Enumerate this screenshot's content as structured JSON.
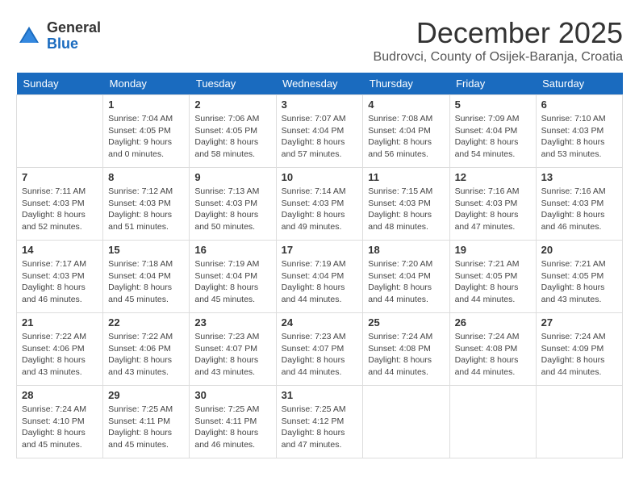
{
  "logo": {
    "general": "General",
    "blue": "Blue"
  },
  "title": {
    "month": "December 2025",
    "location": "Budrovci, County of Osijek-Baranja, Croatia"
  },
  "days_of_week": [
    "Sunday",
    "Monday",
    "Tuesday",
    "Wednesday",
    "Thursday",
    "Friday",
    "Saturday"
  ],
  "weeks": [
    [
      {
        "day": "",
        "sunrise": "",
        "sunset": "",
        "daylight": ""
      },
      {
        "day": "1",
        "sunrise": "Sunrise: 7:04 AM",
        "sunset": "Sunset: 4:05 PM",
        "daylight": "Daylight: 9 hours and 0 minutes."
      },
      {
        "day": "2",
        "sunrise": "Sunrise: 7:06 AM",
        "sunset": "Sunset: 4:05 PM",
        "daylight": "Daylight: 8 hours and 58 minutes."
      },
      {
        "day": "3",
        "sunrise": "Sunrise: 7:07 AM",
        "sunset": "Sunset: 4:04 PM",
        "daylight": "Daylight: 8 hours and 57 minutes."
      },
      {
        "day": "4",
        "sunrise": "Sunrise: 7:08 AM",
        "sunset": "Sunset: 4:04 PM",
        "daylight": "Daylight: 8 hours and 56 minutes."
      },
      {
        "day": "5",
        "sunrise": "Sunrise: 7:09 AM",
        "sunset": "Sunset: 4:04 PM",
        "daylight": "Daylight: 8 hours and 54 minutes."
      },
      {
        "day": "6",
        "sunrise": "Sunrise: 7:10 AM",
        "sunset": "Sunset: 4:03 PM",
        "daylight": "Daylight: 8 hours and 53 minutes."
      }
    ],
    [
      {
        "day": "7",
        "sunrise": "Sunrise: 7:11 AM",
        "sunset": "Sunset: 4:03 PM",
        "daylight": "Daylight: 8 hours and 52 minutes."
      },
      {
        "day": "8",
        "sunrise": "Sunrise: 7:12 AM",
        "sunset": "Sunset: 4:03 PM",
        "daylight": "Daylight: 8 hours and 51 minutes."
      },
      {
        "day": "9",
        "sunrise": "Sunrise: 7:13 AM",
        "sunset": "Sunset: 4:03 PM",
        "daylight": "Daylight: 8 hours and 50 minutes."
      },
      {
        "day": "10",
        "sunrise": "Sunrise: 7:14 AM",
        "sunset": "Sunset: 4:03 PM",
        "daylight": "Daylight: 8 hours and 49 minutes."
      },
      {
        "day": "11",
        "sunrise": "Sunrise: 7:15 AM",
        "sunset": "Sunset: 4:03 PM",
        "daylight": "Daylight: 8 hours and 48 minutes."
      },
      {
        "day": "12",
        "sunrise": "Sunrise: 7:16 AM",
        "sunset": "Sunset: 4:03 PM",
        "daylight": "Daylight: 8 hours and 47 minutes."
      },
      {
        "day": "13",
        "sunrise": "Sunrise: 7:16 AM",
        "sunset": "Sunset: 4:03 PM",
        "daylight": "Daylight: 8 hours and 46 minutes."
      }
    ],
    [
      {
        "day": "14",
        "sunrise": "Sunrise: 7:17 AM",
        "sunset": "Sunset: 4:03 PM",
        "daylight": "Daylight: 8 hours and 46 minutes."
      },
      {
        "day": "15",
        "sunrise": "Sunrise: 7:18 AM",
        "sunset": "Sunset: 4:04 PM",
        "daylight": "Daylight: 8 hours and 45 minutes."
      },
      {
        "day": "16",
        "sunrise": "Sunrise: 7:19 AM",
        "sunset": "Sunset: 4:04 PM",
        "daylight": "Daylight: 8 hours and 45 minutes."
      },
      {
        "day": "17",
        "sunrise": "Sunrise: 7:19 AM",
        "sunset": "Sunset: 4:04 PM",
        "daylight": "Daylight: 8 hours and 44 minutes."
      },
      {
        "day": "18",
        "sunrise": "Sunrise: 7:20 AM",
        "sunset": "Sunset: 4:04 PM",
        "daylight": "Daylight: 8 hours and 44 minutes."
      },
      {
        "day": "19",
        "sunrise": "Sunrise: 7:21 AM",
        "sunset": "Sunset: 4:05 PM",
        "daylight": "Daylight: 8 hours and 44 minutes."
      },
      {
        "day": "20",
        "sunrise": "Sunrise: 7:21 AM",
        "sunset": "Sunset: 4:05 PM",
        "daylight": "Daylight: 8 hours and 43 minutes."
      }
    ],
    [
      {
        "day": "21",
        "sunrise": "Sunrise: 7:22 AM",
        "sunset": "Sunset: 4:06 PM",
        "daylight": "Daylight: 8 hours and 43 minutes."
      },
      {
        "day": "22",
        "sunrise": "Sunrise: 7:22 AM",
        "sunset": "Sunset: 4:06 PM",
        "daylight": "Daylight: 8 hours and 43 minutes."
      },
      {
        "day": "23",
        "sunrise": "Sunrise: 7:23 AM",
        "sunset": "Sunset: 4:07 PM",
        "daylight": "Daylight: 8 hours and 43 minutes."
      },
      {
        "day": "24",
        "sunrise": "Sunrise: 7:23 AM",
        "sunset": "Sunset: 4:07 PM",
        "daylight": "Daylight: 8 hours and 44 minutes."
      },
      {
        "day": "25",
        "sunrise": "Sunrise: 7:24 AM",
        "sunset": "Sunset: 4:08 PM",
        "daylight": "Daylight: 8 hours and 44 minutes."
      },
      {
        "day": "26",
        "sunrise": "Sunrise: 7:24 AM",
        "sunset": "Sunset: 4:08 PM",
        "daylight": "Daylight: 8 hours and 44 minutes."
      },
      {
        "day": "27",
        "sunrise": "Sunrise: 7:24 AM",
        "sunset": "Sunset: 4:09 PM",
        "daylight": "Daylight: 8 hours and 44 minutes."
      }
    ],
    [
      {
        "day": "28",
        "sunrise": "Sunrise: 7:24 AM",
        "sunset": "Sunset: 4:10 PM",
        "daylight": "Daylight: 8 hours and 45 minutes."
      },
      {
        "day": "29",
        "sunrise": "Sunrise: 7:25 AM",
        "sunset": "Sunset: 4:11 PM",
        "daylight": "Daylight: 8 hours and 45 minutes."
      },
      {
        "day": "30",
        "sunrise": "Sunrise: 7:25 AM",
        "sunset": "Sunset: 4:11 PM",
        "daylight": "Daylight: 8 hours and 46 minutes."
      },
      {
        "day": "31",
        "sunrise": "Sunrise: 7:25 AM",
        "sunset": "Sunset: 4:12 PM",
        "daylight": "Daylight: 8 hours and 47 minutes."
      },
      {
        "day": "",
        "sunrise": "",
        "sunset": "",
        "daylight": ""
      },
      {
        "day": "",
        "sunrise": "",
        "sunset": "",
        "daylight": ""
      },
      {
        "day": "",
        "sunrise": "",
        "sunset": "",
        "daylight": ""
      }
    ]
  ]
}
